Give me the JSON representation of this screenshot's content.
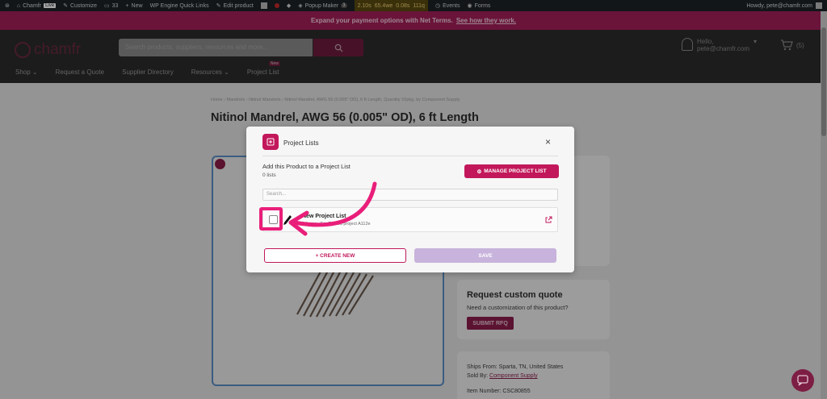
{
  "admin_bar": {
    "site_name": "Chamfr",
    "live_badge": "Live",
    "customize": "Customize",
    "comments_count": "33",
    "new": "New",
    "wp_engine": "WP Engine Quick Links",
    "edit_product": "Edit product",
    "popup_maker": "Popup Maker",
    "popup_count": "3",
    "perf_metrics": [
      "2.10s",
      "65.4we",
      "0.08s",
      "111q"
    ],
    "events": "Events",
    "forms": "Forms",
    "howdy": "Howdy, pete@chamfr.com"
  },
  "promo": {
    "text": "Expand your payment options with Net Terms.",
    "link": "See how they work."
  },
  "header": {
    "logo_text": "chamfr",
    "search_placeholder": "Search products, suppliers, resources and more...",
    "account_hello": "Hello,",
    "account_email": "pete@chamfr.com",
    "cart_count": "(5)",
    "nav": [
      "Shop",
      "Request a Quote",
      "Supplier Directory",
      "Resources",
      "Project List"
    ],
    "nav_new_badge": "New"
  },
  "page": {
    "breadcrumb": "Home › Mandrels › Nitinol Mandrels › Nitinol Mandrel, AWG 56 (0.005\" OD), 6 ft Length, Quantity 10pkg, by Component Supply",
    "title": "Nitinol Mandrel, AWG 56 (0.005\" OD), 6 ft Length",
    "rfq_title": "Request custom quote",
    "rfq_subtitle": "Need a customization of this product?",
    "rfq_button": "SUBMIT RFQ",
    "ships_from": "Ships From: Sparta, TN, United States",
    "sold_by_label": "Sold By:",
    "sold_by": "Component Supply",
    "item_number": "Item Number: CSC80855"
  },
  "modal": {
    "title": "Project Lists",
    "add_heading": "Add this Product to a Project List",
    "list_count": "0 lists",
    "manage_button": "MANAGE PROJECT LIST",
    "search_placeholder": "Search...",
    "lists": [
      {
        "name": "New Project List",
        "description": "1 items - For Embed project A112e"
      }
    ],
    "create_button": "+ CREATE NEW",
    "save_button": "SAVE"
  },
  "colors": {
    "brand": "#c2185b",
    "highlight": "#e91e7a",
    "promo_bg": "#a3205a"
  }
}
